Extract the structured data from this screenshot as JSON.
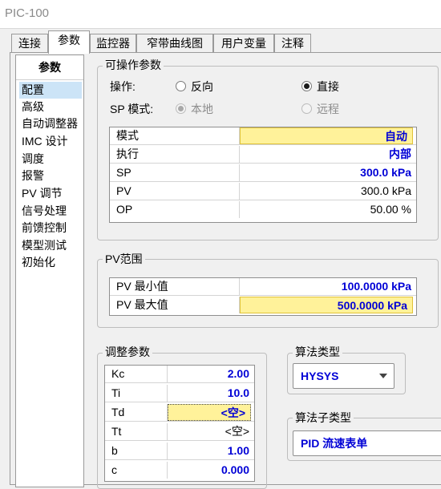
{
  "window": {
    "title": "PIC-100"
  },
  "tabs": [
    {
      "label": "连接"
    },
    {
      "label": "参数"
    },
    {
      "label": "监控器"
    },
    {
      "label": "窄带曲线图"
    },
    {
      "label": "用户变量"
    },
    {
      "label": "注释"
    }
  ],
  "sidebar": {
    "header": "参数",
    "items": [
      {
        "label": "配置"
      },
      {
        "label": "高级"
      },
      {
        "label": "自动调整器"
      },
      {
        "label": "IMC 设计"
      },
      {
        "label": "调度"
      },
      {
        "label": "报警"
      },
      {
        "label": "PV 调节"
      },
      {
        "label": "信号处理"
      },
      {
        "label": "前馈控制"
      },
      {
        "label": "模型测试"
      },
      {
        "label": "初始化"
      }
    ]
  },
  "operable": {
    "title": "可操作参数",
    "action_label": "操作:",
    "reverse_label": "反向",
    "direct_label": "直接",
    "sp_mode_label": "SP 模式:",
    "local_label": "本地",
    "remote_label": "远程",
    "rows": [
      {
        "key": "模式",
        "value": "自动"
      },
      {
        "key": "执行",
        "value": "内部"
      },
      {
        "key": "SP",
        "value": "300.0 kPa"
      },
      {
        "key": "PV",
        "value": "300.0 kPa"
      },
      {
        "key": "OP",
        "value": "50.00 %"
      }
    ]
  },
  "pv_range": {
    "title": "PV范围",
    "rows": [
      {
        "key": "PV 最小值",
        "value": "100.0000 kPa"
      },
      {
        "key": "PV 最大值",
        "value": "500.0000 kPa"
      }
    ]
  },
  "tuning": {
    "title": "调整参数",
    "rows": [
      {
        "key": "Kc",
        "value": "2.00"
      },
      {
        "key": "Ti",
        "value": "10.0"
      },
      {
        "key": "Td",
        "value": "<空>"
      },
      {
        "key": "Tt",
        "value": "<空>"
      },
      {
        "key": "b",
        "value": "1.00"
      },
      {
        "key": "c",
        "value": "0.000"
      }
    ]
  },
  "algorithm": {
    "type_title": "算法类型",
    "type_value": "HYSYS",
    "subtype_title": "算法子类型",
    "subtype_value": "PID 流速表单"
  },
  "colors": {
    "value_blue": "#0000d6",
    "highlight": "#fff29a",
    "selection": "#cce4f7"
  }
}
